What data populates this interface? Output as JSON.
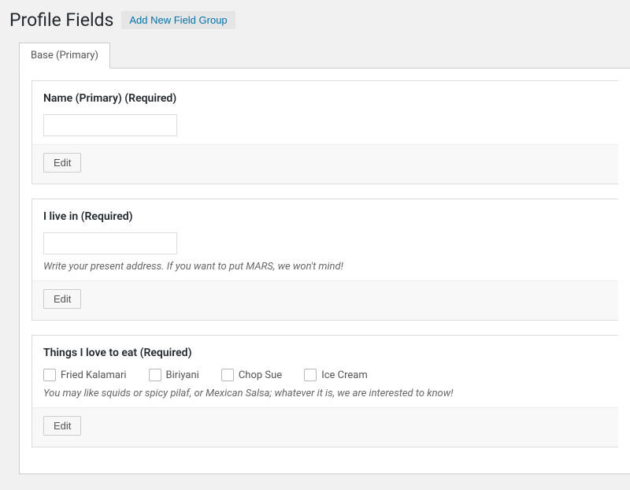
{
  "header": {
    "title": "Profile Fields",
    "add_label": "Add New Field Group"
  },
  "tabs": {
    "primary": "Base (Primary)"
  },
  "fields": [
    {
      "title": "Name (Primary) (Required)",
      "type": "text",
      "value": "",
      "hint": "",
      "edit_label": "Edit"
    },
    {
      "title": "I live in (Required)",
      "type": "text",
      "value": "",
      "hint": "Write your present address. If you want to put MARS, we won't mind!",
      "edit_label": "Edit"
    },
    {
      "title": "Things I love to eat (Required)",
      "type": "checkbox",
      "options": [
        "Fried Kalamari",
        "Biriyani",
        "Chop Sue",
        "Ice Cream"
      ],
      "hint": "You may like squids or spicy pilaf, or Mexican Salsa; whatever it is, we are interested to know!",
      "edit_label": "Edit"
    }
  ]
}
